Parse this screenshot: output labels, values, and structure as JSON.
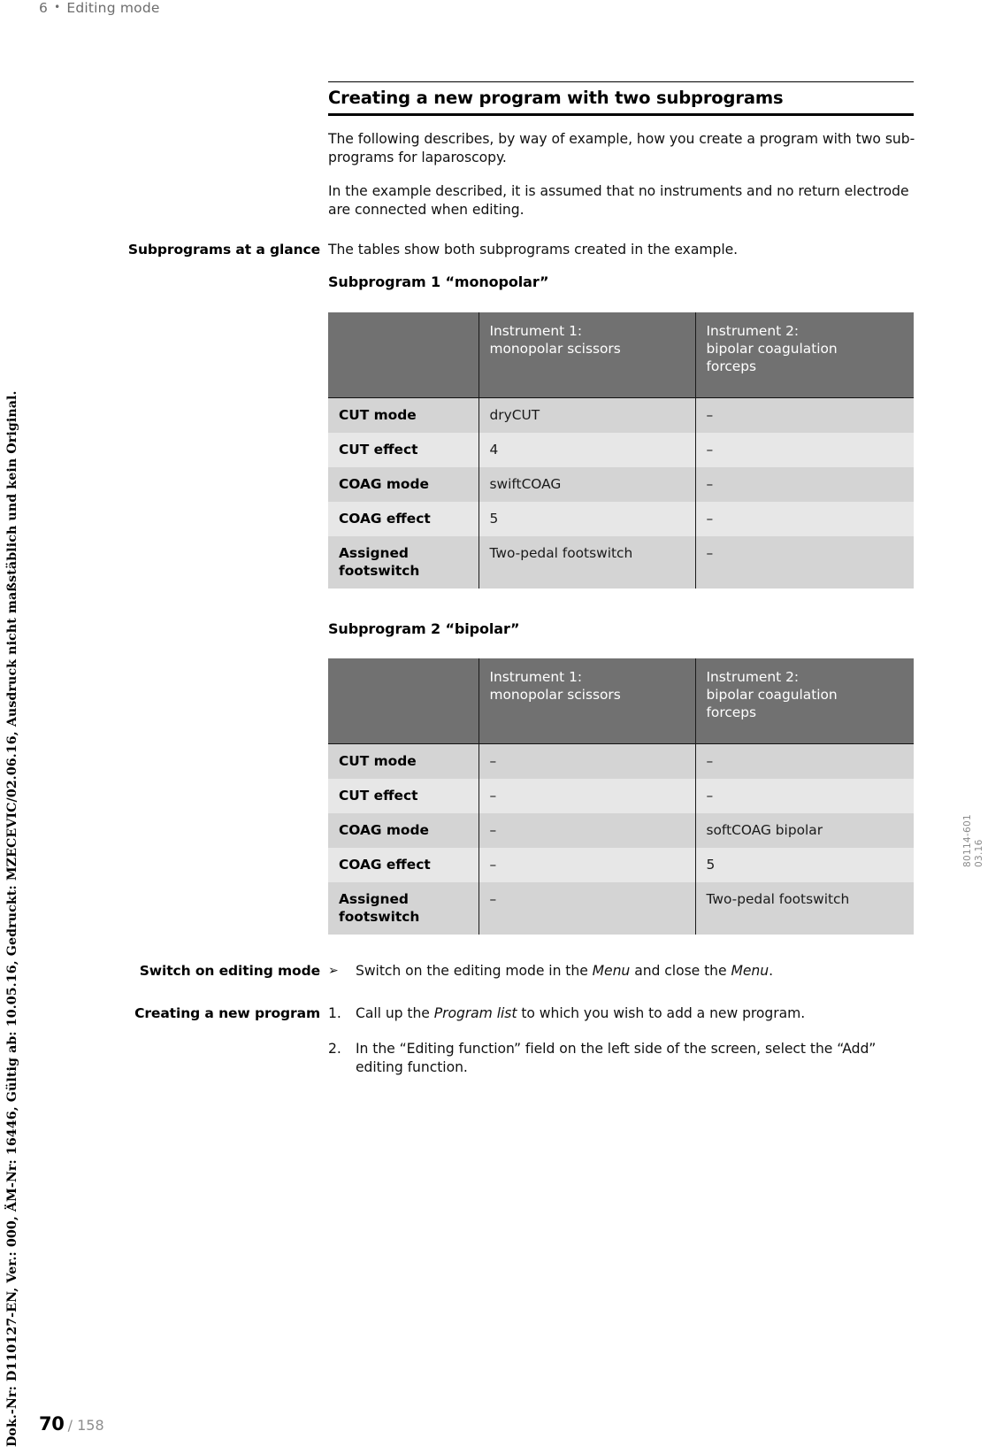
{
  "header": {
    "chapter_number": "6",
    "separator": "•",
    "chapter_title": "Editing mode"
  },
  "footer": {
    "page": "70",
    "total": "/ 158"
  },
  "left_margin_legal": "Dok.-Nr: D110127-EN, Ver.: 000, ÄM-Nr: 16446, Gültig ab: 10.05.16, Gedruckt: MZECEVIC/02.06.16, Ausdruck nicht maßstäblich und kein Original.",
  "right_margin": {
    "doc_code": "80114-601",
    "doc_date": "03.16"
  },
  "section": {
    "title": "Creating a new program with two subprograms",
    "paragraph_1": "The following describes, by way of example, how you create a program with two sub-programs for laparoscopy.",
    "paragraph_2": "In the example described, it is assumed that no instruments and no return electrode are connected when editing."
  },
  "subprograms_at_a_glance": {
    "margin_label": "Subprograms at a glance",
    "intro": "The tables show both subprograms created in the example."
  },
  "table1": {
    "caption": "Subprogram 1 “monopolar”",
    "headers": [
      "",
      "Instrument 1:\nmonopolar scissors",
      "Instrument 2:\nbipolar coagulation forceps"
    ],
    "header_col2_line1": "Instrument 1:",
    "header_col2_line2": "monopolar scissors",
    "header_col3_line1": "Instrument 2:",
    "header_col3_line2": "bipolar coagulation",
    "header_col3_line3": "forceps",
    "rows": [
      {
        "label": "CUT mode",
        "c2": "dryCUT",
        "c3": "–"
      },
      {
        "label": "CUT effect",
        "c2": "4",
        "c3": "–"
      },
      {
        "label": "COAG mode",
        "c2": "swiftCOAG",
        "c3": "–"
      },
      {
        "label": "COAG effect",
        "c2": "5",
        "c3": "–"
      },
      {
        "label": "Assigned\nfootswitch",
        "label_l1": "Assigned",
        "label_l2": "footswitch",
        "c2": "Two-pedal footswitch",
        "c3": "–"
      }
    ]
  },
  "table2": {
    "caption": "Subprogram 2 “bipolar”",
    "header_col2_line1": "Instrument 1:",
    "header_col2_line2": "monopolar scissors",
    "header_col3_line1": "Instrument 2:",
    "header_col3_line2": "bipolar coagulation",
    "header_col3_line3": "forceps",
    "rows": [
      {
        "label": "CUT mode",
        "c2": "–",
        "c3": "–"
      },
      {
        "label": "CUT effect",
        "c2": "–",
        "c3": "–"
      },
      {
        "label": "COAG mode",
        "c2": "–",
        "c3": "softCOAG bipolar"
      },
      {
        "label": "COAG effect",
        "c2": "–",
        "c3": "5"
      },
      {
        "label": "Assigned\nfootswitch",
        "label_l1": "Assigned",
        "label_l2": "footswitch",
        "c2": "–",
        "c3": "Two-pedal footswitch"
      }
    ]
  },
  "switch_on_editing_mode": {
    "margin_label": "Switch on editing mode",
    "marker": "➢",
    "text_before": "Switch on the editing mode in the ",
    "italic_1": "Menu",
    "text_middle": " and close the ",
    "italic_2": "Menu",
    "text_after": "."
  },
  "creating_a_new_program": {
    "margin_label": "Creating a new program",
    "steps": [
      {
        "marker": "1.",
        "text_before": "Call up the ",
        "italic": "Program list",
        "text_after": " to which you wish to add a new program."
      },
      {
        "marker": "2.",
        "text_plain": "In the “Editing function” field on the left side of the screen, select the “Add” editing function."
      }
    ]
  }
}
